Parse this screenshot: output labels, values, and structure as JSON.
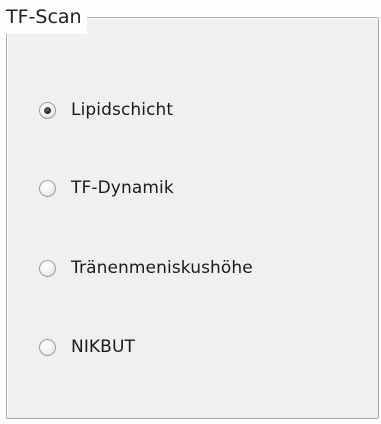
{
  "group": {
    "title": "TF-Scan"
  },
  "options": [
    {
      "label": "Lipidschicht",
      "selected": true
    },
    {
      "label": "TF-Dynamik",
      "selected": false
    },
    {
      "label": "Tränenmeniskushöhe",
      "selected": false
    },
    {
      "label": "NIKBUT",
      "selected": false
    }
  ]
}
